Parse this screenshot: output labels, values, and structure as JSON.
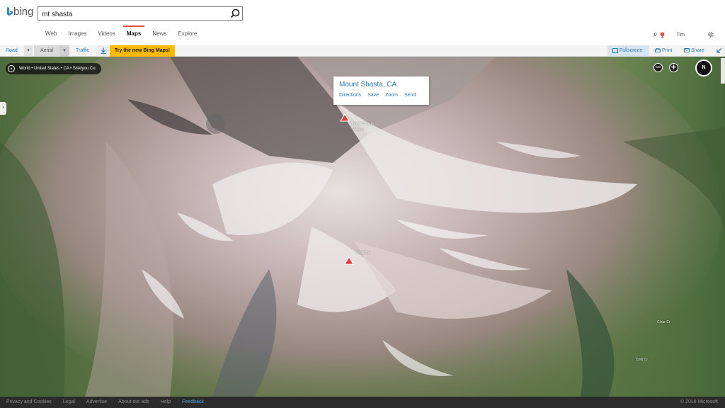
{
  "brand": {
    "logo_text": "bing"
  },
  "search": {
    "value": "mt shasta"
  },
  "nav": {
    "items": [
      {
        "label": "Web"
      },
      {
        "label": "Images"
      },
      {
        "label": "Videos"
      },
      {
        "label": "Maps",
        "active": true
      },
      {
        "label": "News"
      },
      {
        "label": "Explore"
      }
    ]
  },
  "user": {
    "rewards_count": "0",
    "name": "Tim"
  },
  "toolbar": {
    "road": "Road",
    "road_dropdown": "▾",
    "aerial": "Aerial",
    "aerial_dropdown": "▾",
    "traffic": "Traffic",
    "new_maps": "Try the new Bing Maps!",
    "fullscreen": "Fullscreen",
    "print": "Print",
    "share": "Share"
  },
  "map": {
    "breadcrumb": "World • United States • CA • Siskiyou Co.",
    "zoom_out": "−",
    "zoom_in": "+",
    "compass": "N",
    "panel_toggle": "›",
    "labels": {
      "mount_shasta": "Mount Shasta",
      "elev": "14162 ft",
      "shastina": "Shastina",
      "clear_cr": "Clear Cr",
      "cold_cr": "Cold Cr"
    },
    "infobox": {
      "title": "Mount Shasta, CA",
      "actions": [
        "Directions",
        "Save",
        "Zoom",
        "Send"
      ]
    }
  },
  "footer": {
    "links": [
      "Privacy and Cookies",
      "Legal",
      "Advertise",
      "About our ads",
      "Help",
      "Feedback"
    ],
    "copyright": "© 2016 Microsoft"
  },
  "colors": {
    "accent_blue": "#2a7ab8",
    "active_tab": "#e2513a",
    "promo": "#ffb900",
    "footer_bg": "#2b2b2b"
  }
}
